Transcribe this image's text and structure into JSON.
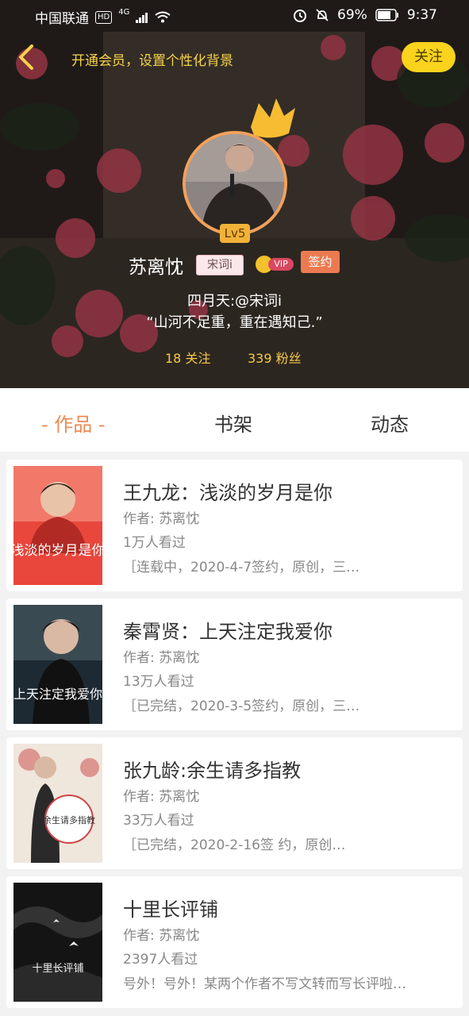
{
  "status_bar": {
    "carrier": "中国联通",
    "hd": "HD",
    "network": "4G",
    "battery_percent": "69%",
    "time": "9:37"
  },
  "header": {
    "back_icon": "chevron-left-icon",
    "vip_tip": "开通会员，设置个性化背景",
    "follow_label": "关注"
  },
  "profile": {
    "level": "Lv5",
    "name": "苏离忱",
    "name_tag": "宋词i",
    "vip_label": "VIP",
    "signed_label": "签约",
    "bio_line1": "四月天:@宋词i",
    "bio_line2": "“山河不足重，重在遇知己.”",
    "following": "18 关注",
    "fans": "339 粉丝"
  },
  "tabs": [
    {
      "label": "- 作品 -",
      "active": true
    },
    {
      "label": "书架",
      "active": false
    },
    {
      "label": "动态",
      "active": false
    }
  ],
  "books": [
    {
      "title": "王九龙：浅淡的岁月是你",
      "author": "作者: 苏离忱",
      "views": "1万人看过",
      "desc": "［连载中，2020-4-7签约，原创，三…",
      "cover_text": "浅淡的岁月是你"
    },
    {
      "title": "秦霄贤：上天注定我爱你",
      "author": "作者: 苏离忱",
      "views": "13万人看过",
      "desc": "［已完结，2020-3-5签约，原创，三…",
      "cover_text": "上天注定我爱你"
    },
    {
      "title": "张九龄:余生请多指教",
      "author": "作者: 苏离忱",
      "views": "33万人看过",
      "desc": "［已完结，2020-2-16签 约，原创…",
      "cover_text": "余生请多指教"
    },
    {
      "title": "十里长评铺",
      "author": "作者: 苏离忱",
      "views": "2397人看过",
      "desc": "号外！号外！某两个作者不写文转而写长评啦…",
      "cover_text": "十里长评铺"
    }
  ]
}
